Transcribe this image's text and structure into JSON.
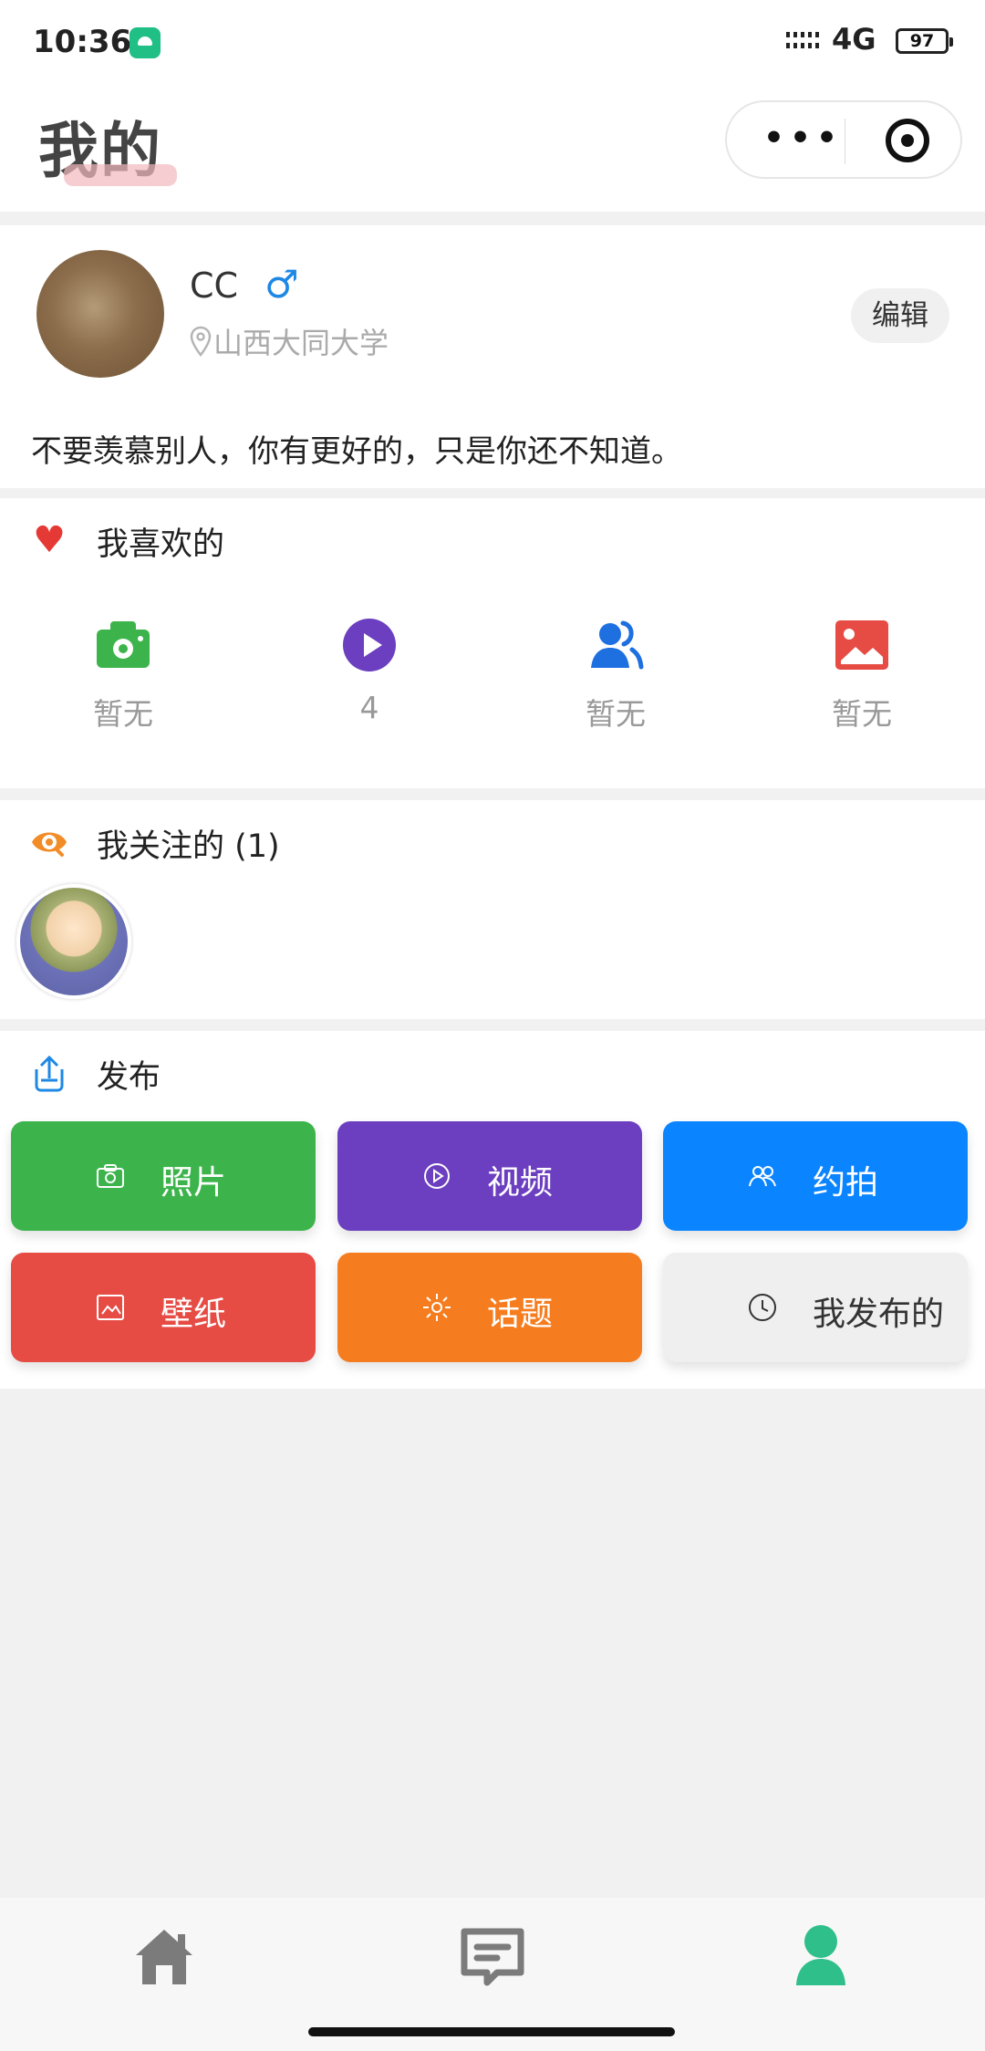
{
  "status_bar": {
    "time": "10:36",
    "network": "4G",
    "battery": "97"
  },
  "header": {
    "title": "我的"
  },
  "profile": {
    "name": "CC",
    "gender_symbol": "♂",
    "school": "山西大同大学",
    "edit_label": "编辑",
    "bio": "不要羡慕别人，你有更好的，只是你还不知道。"
  },
  "likes": {
    "title": "我喜欢的",
    "items": [
      {
        "icon": "camera-icon",
        "label": "暂无"
      },
      {
        "icon": "play-icon",
        "label": "4"
      },
      {
        "icon": "users-icon",
        "label": "暂无"
      },
      {
        "icon": "image-icon",
        "label": "暂无"
      }
    ]
  },
  "following": {
    "title": "我关注的 (1)"
  },
  "publish": {
    "title": "发布",
    "buttons": [
      {
        "label": "照片",
        "icon": "camera-icon"
      },
      {
        "label": "视频",
        "icon": "play-circle-icon"
      },
      {
        "label": "约拍",
        "icon": "users-icon"
      },
      {
        "label": "壁纸",
        "icon": "image-icon"
      },
      {
        "label": "话题",
        "icon": "sparkle-icon"
      },
      {
        "label": "我发布的",
        "icon": "clock-icon"
      }
    ]
  },
  "colors": {
    "green": "#3cb44b",
    "purple": "#6b3fbf",
    "blue": "#0b84ff",
    "red": "#e64b44",
    "orange": "#f57d1f",
    "gray": "#efefef",
    "teal": "#2fbf8a"
  }
}
